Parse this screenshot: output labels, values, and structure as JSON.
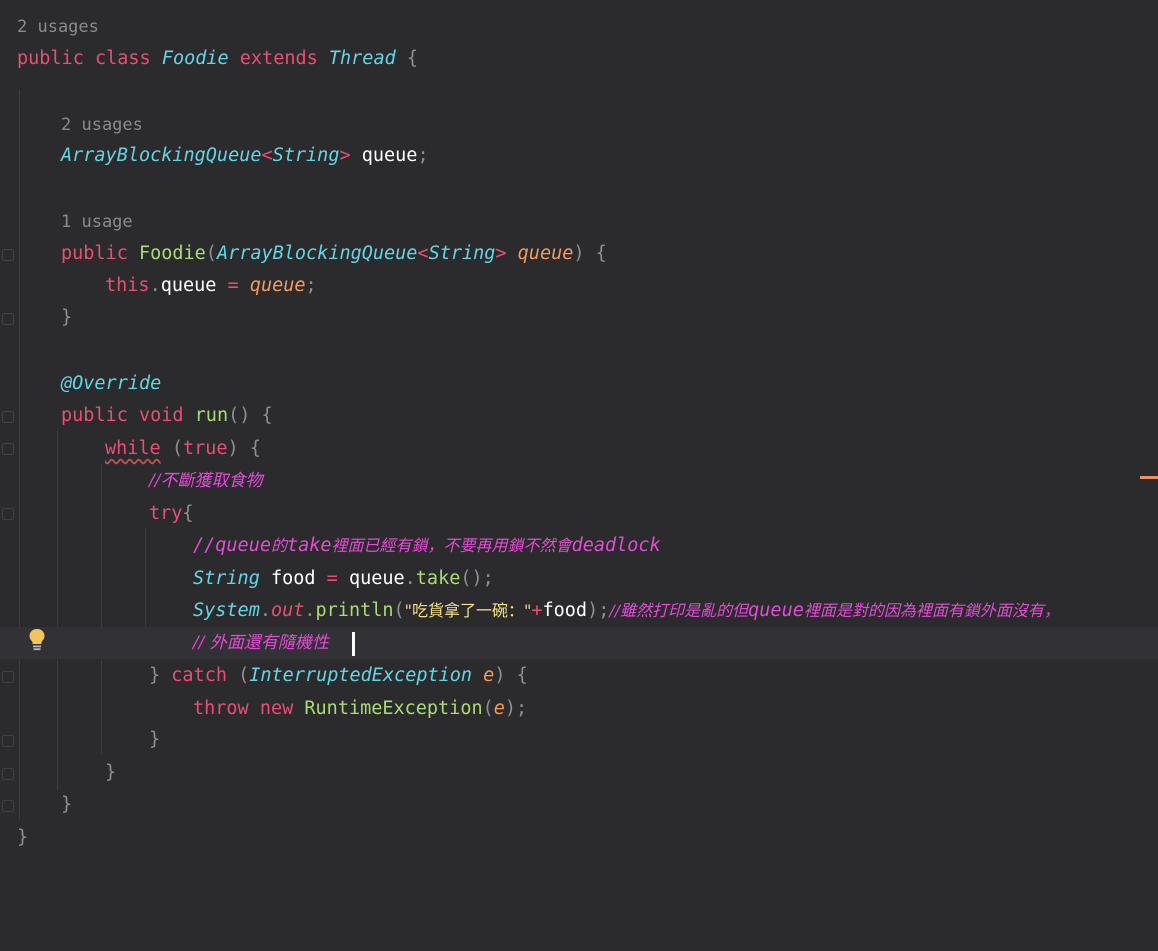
{
  "editor": {
    "language": "Java",
    "usages": {
      "class": "2 usages",
      "field": "2 usages",
      "constructor": "1 usage"
    },
    "tokens": {
      "public": "public",
      "class": "class",
      "extends": "extends",
      "void": "void",
      "while": "while",
      "true": "true",
      "try": "try",
      "catch": "catch",
      "throw": "throw",
      "new": "new",
      "this": "this",
      "class_name": "Foodie",
      "super_class": "Thread",
      "queue_type": "ArrayBlockingQueue",
      "string_type": "String",
      "field_name": "queue",
      "param_name": "queue",
      "annotation": "@Override",
      "method_run": "run",
      "local_food": "food",
      "method_take": "take",
      "system": "System",
      "out": "out",
      "println": "println",
      "string_literal": "\"吃貨拿了一碗：\"",
      "exception_type": "InterruptedException",
      "exception_var": "e",
      "runtime_exception": "RuntimeException"
    },
    "comments": {
      "get_food": "//不斷獲取食物",
      "take_lock_prefix": "//queue",
      "take_lock_de": "的",
      "take_lock_take": "take",
      "take_lock_mid": "裡面已經有鎖，不要再用鎖不然會",
      "take_lock_deadlock": "deadlock",
      "print_prefix": "//雖然打印是亂的但",
      "print_queue": "queue",
      "print_rest": "裡面是對的因為裡面有鎖外面沒有，",
      "outside_random": "// 外面還有隨機性"
    }
  }
}
